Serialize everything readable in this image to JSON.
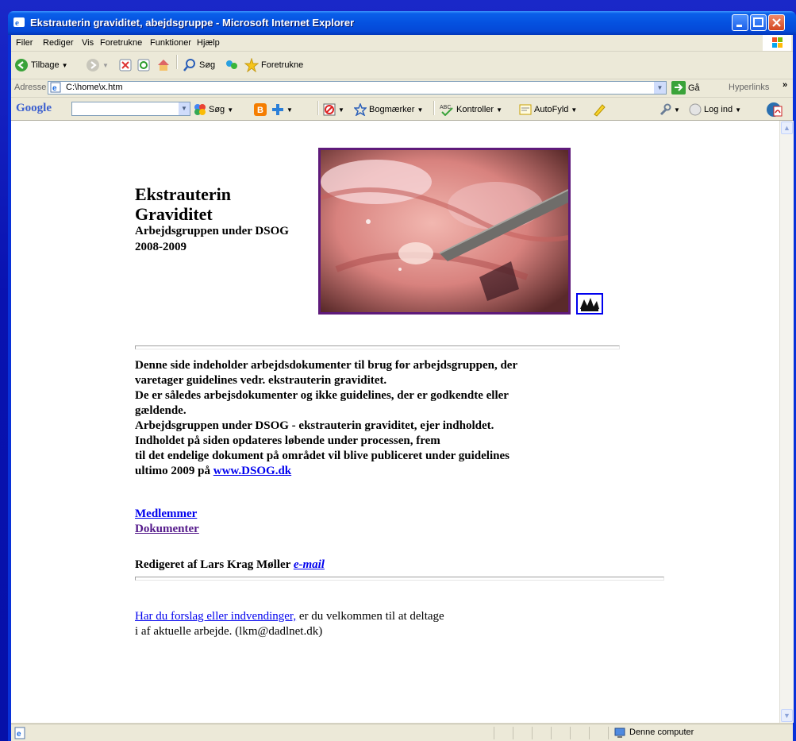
{
  "window": {
    "title": "Ekstrauterin graviditet, abejdsgruppe - Microsoft Internet Explorer"
  },
  "menu": [
    "Filer",
    "Rediger",
    "Vis",
    "Foretrukne",
    "Funktioner",
    "Hjælp"
  ],
  "toolbar": {
    "back_label": "Tilbage",
    "search_label": "Søg",
    "favorites_label": "Foretrukne"
  },
  "address": {
    "label": "Adresse",
    "value": "C:\\home\\x.htm",
    "go_label": "Gå",
    "hyperlinks_label": "Hyperlinks",
    "more": "»"
  },
  "google": {
    "logo": "Google",
    "search_label": "Søg",
    "bookmarks_label": "Bogmærker",
    "check_label": "Kontroller",
    "autofill_label": "AutoFyld",
    "login_label": "Log ind"
  },
  "page": {
    "title_line1": "Ekstrauterin",
    "title_line2": "Graviditet",
    "subtitle": "Arbejdsgruppen under DSOG",
    "years": "2008-2009",
    "body_lines": [
      "Denne side indeholder arbejdsdokumenter til brug for arbejdsgruppen, der",
      "varetager guidelines vedr. ekstrauterin graviditet.",
      "De er således arbejsdokumenter og ikke guidelines, der er godkendte eller",
      "gældende.",
      "Arbejdsgruppen under DSOG - ekstrauterin graviditet, ejer indholdet.",
      "Indholdet på siden opdateres løbende under processen, frem",
      "til det endelige dokument på området vil blive publiceret under guidelines"
    ],
    "last_line_prefix": "ultimo 2009 på ",
    "dsog_link": "www.DSOG.dk",
    "link_members": "Medlemmer",
    "link_documents": "Dokumenter",
    "edited_by": "Redigeret af Lars Krag Møller ",
    "email_link": "e-mail",
    "footer_link": "Har du forslag eller indvendinger,",
    "footer_rest": " er du velkommen til at deltage",
    "footer_line2": "i af aktuelle arbejde. (lkm@dadlnet.dk)"
  },
  "status": {
    "zone": "Denne computer"
  },
  "colors": {
    "desktop": "#0a15b8",
    "titlebar": "#0551e0",
    "chrome": "#ece9d8",
    "link": "#0000ee",
    "visited": "#551a8b",
    "photo_border": "#5e1a7a"
  }
}
